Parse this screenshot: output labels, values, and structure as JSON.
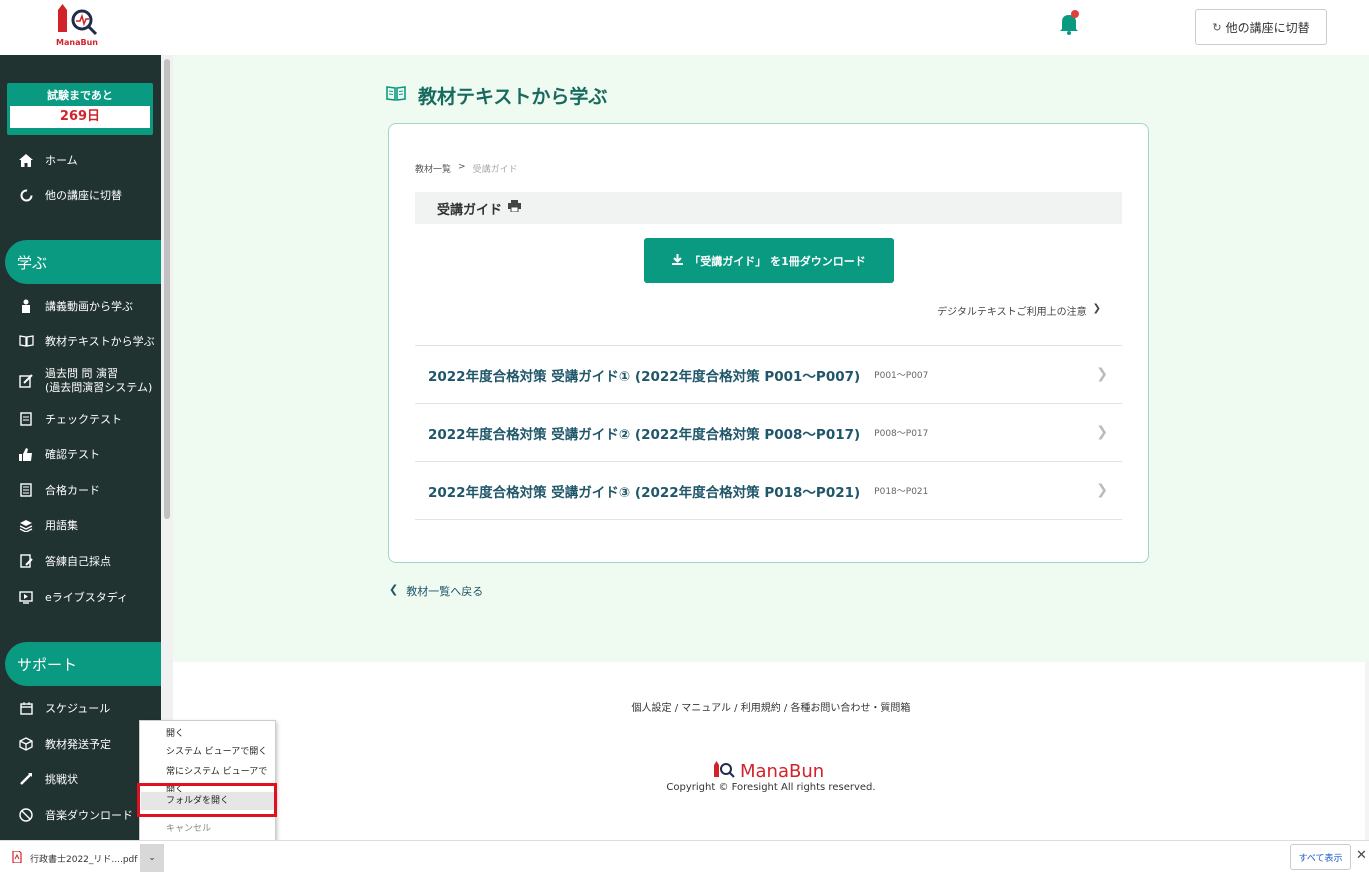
{
  "header": {
    "logo_text": "ManaBun",
    "switch_label": "他の講座に切替",
    "switch_icon": "↻"
  },
  "sidebar": {
    "countdown_label": "試験まであと",
    "countdown_value": "269日",
    "top_items": [
      {
        "label": "ホーム",
        "icon": "home-icon"
      },
      {
        "label": "他の講座に切替",
        "icon": "refresh-icon"
      }
    ],
    "learn_heading": "学ぶ",
    "learn_items": [
      {
        "label": "講義動画から学ぶ",
        "icon": "teacher-icon"
      },
      {
        "label": "教材テキストから学ぶ",
        "icon": "book-icon"
      },
      {
        "label": "過去問 問 演習\n(過去問演習システム)",
        "icon": "edit-icon"
      },
      {
        "label": "チェックテスト",
        "icon": "checklist-icon"
      },
      {
        "label": "確認テスト",
        "icon": "thumbs-up-icon"
      },
      {
        "label": "合格カード",
        "icon": "card-icon"
      },
      {
        "label": "用語集",
        "icon": "glossary-icon"
      },
      {
        "label": "答練自己採点",
        "icon": "score-icon"
      },
      {
        "label": "eライブスタディ",
        "icon": "live-icon"
      }
    ],
    "support_heading": "サポート",
    "support_items": [
      {
        "label": "スケジュール",
        "icon": "calendar-icon"
      },
      {
        "label": "教材発送予定",
        "icon": "box-icon"
      },
      {
        "label": "挑戦状",
        "icon": "challenge-icon"
      },
      {
        "label": "音楽ダウンロード",
        "icon": "download-icon"
      }
    ]
  },
  "main": {
    "page_title": "教材テキストから学ぶ",
    "breadcrumb": [
      "教材一覧",
      ">",
      "受講ガイド"
    ],
    "guide_title": "受講ガイド",
    "download_button": "「受講ガイド」 を1冊ダウンロード",
    "digital_link": "デジタルテキストご利用上の注意",
    "items": [
      {
        "title": "2022年度合格対策 受講ガイド① (2022年度合格対策 P001～P007)",
        "pages": "P001～P007"
      },
      {
        "title": "2022年度合格対策 受講ガイド② (2022年度合格対策 P008～P017)",
        "pages": "P008～P017"
      },
      {
        "title": "2022年度合格対策 受講ガイド③ (2022年度合格対策 P018～P021)",
        "pages": "P018～P021"
      }
    ],
    "back_link": "教材一覧へ戻る"
  },
  "footer": {
    "links": "個人設定 / マニュアル / 利用規約 / 各種お問い合わせ・質問箱",
    "logo": "ManaBun",
    "copyright": "Copyright © Foresight All rights reserved."
  },
  "context_menu": {
    "items": [
      "開く",
      "システム ビューアで開く",
      "常にシステム ビューアで開く",
      "フォルダを開く",
      "キャンセル"
    ]
  },
  "download_bar": {
    "filename": "行政書士2022_リド....pdf",
    "caret": "⌄",
    "show_all": "すべて表示",
    "close": "✕"
  },
  "colors": {
    "sidebar_bg": "#213331",
    "accent": "#0a9a82",
    "main_bg": "#effaf1",
    "title": "#166b5e",
    "highlight": "#e0101e"
  }
}
